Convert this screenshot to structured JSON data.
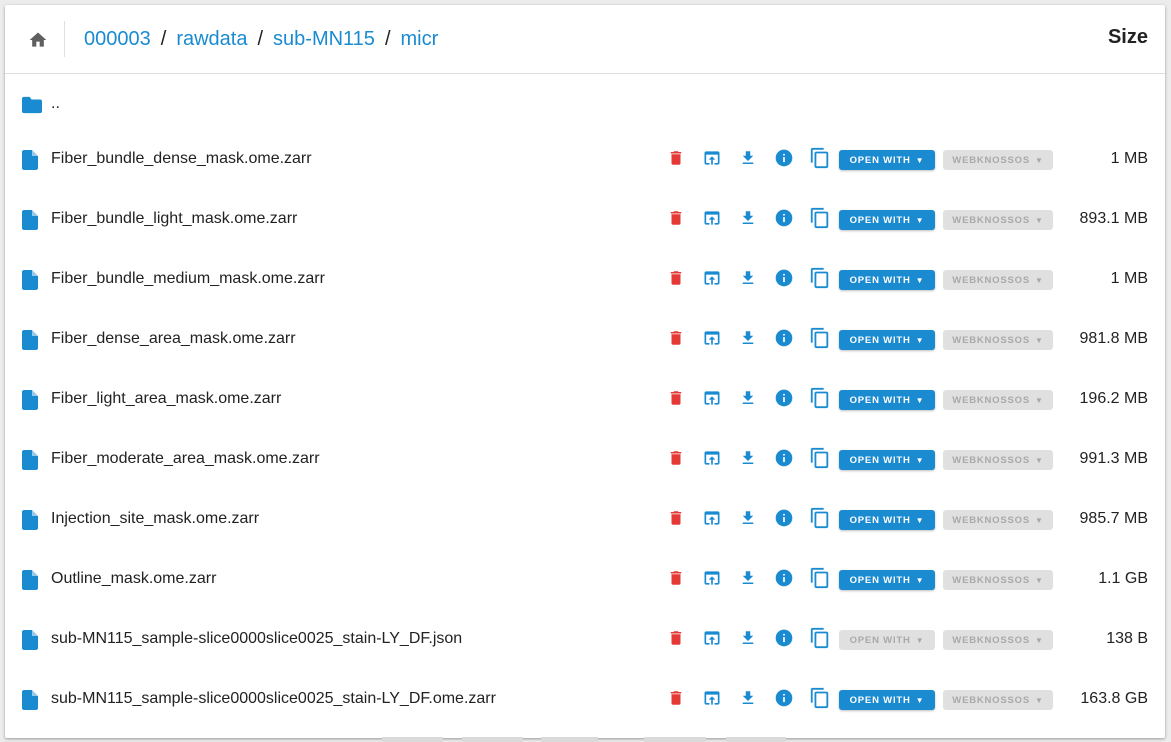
{
  "breadcrumb": [
    "000003",
    "rawdata",
    "sub-MN115",
    "micr"
  ],
  "breadcrumb_separator": "/",
  "header": {
    "size_label": "Size"
  },
  "parent_dir": {
    "label": ".."
  },
  "actions": {
    "open_with_label": "OPEN WITH",
    "webknossos_label": "WEBKNOSSOS",
    "caret": "▼"
  },
  "icons": {
    "home": "home-icon",
    "folder": "folder-icon",
    "file": "file-icon",
    "delete": "trash-icon",
    "upload": "open-in-new-icon",
    "download": "download-icon",
    "info": "info-icon",
    "copy": "copy-icon"
  },
  "colors": {
    "accent": "#1a8bd0",
    "delete": "#e53935",
    "disabled_bg": "#e0e0e0",
    "disabled_text": "#a9a9a9"
  },
  "files": [
    {
      "name": "Fiber_bundle_dense_mask.ome.zarr",
      "size": "1 MB",
      "open_with_enabled": true
    },
    {
      "name": "Fiber_bundle_light_mask.ome.zarr",
      "size": "893.1 MB",
      "open_with_enabled": true
    },
    {
      "name": "Fiber_bundle_medium_mask.ome.zarr",
      "size": "1 MB",
      "open_with_enabled": true
    },
    {
      "name": "Fiber_dense_area_mask.ome.zarr",
      "size": "981.8 MB",
      "open_with_enabled": true
    },
    {
      "name": "Fiber_light_area_mask.ome.zarr",
      "size": "196.2 MB",
      "open_with_enabled": true
    },
    {
      "name": "Fiber_moderate_area_mask.ome.zarr",
      "size": "991.3 MB",
      "open_with_enabled": true
    },
    {
      "name": "Injection_site_mask.ome.zarr",
      "size": "985.7 MB",
      "open_with_enabled": true
    },
    {
      "name": "Outline_mask.ome.zarr",
      "size": "1.1 GB",
      "open_with_enabled": true
    },
    {
      "name": "sub-MN115_sample-slice0000slice0025_stain-LY_DF.json",
      "size": "138 B",
      "open_with_enabled": false
    },
    {
      "name": "sub-MN115_sample-slice0000slice0025_stain-LY_DF.ome.zarr",
      "size": "163.8 GB",
      "open_with_enabled": true
    }
  ]
}
